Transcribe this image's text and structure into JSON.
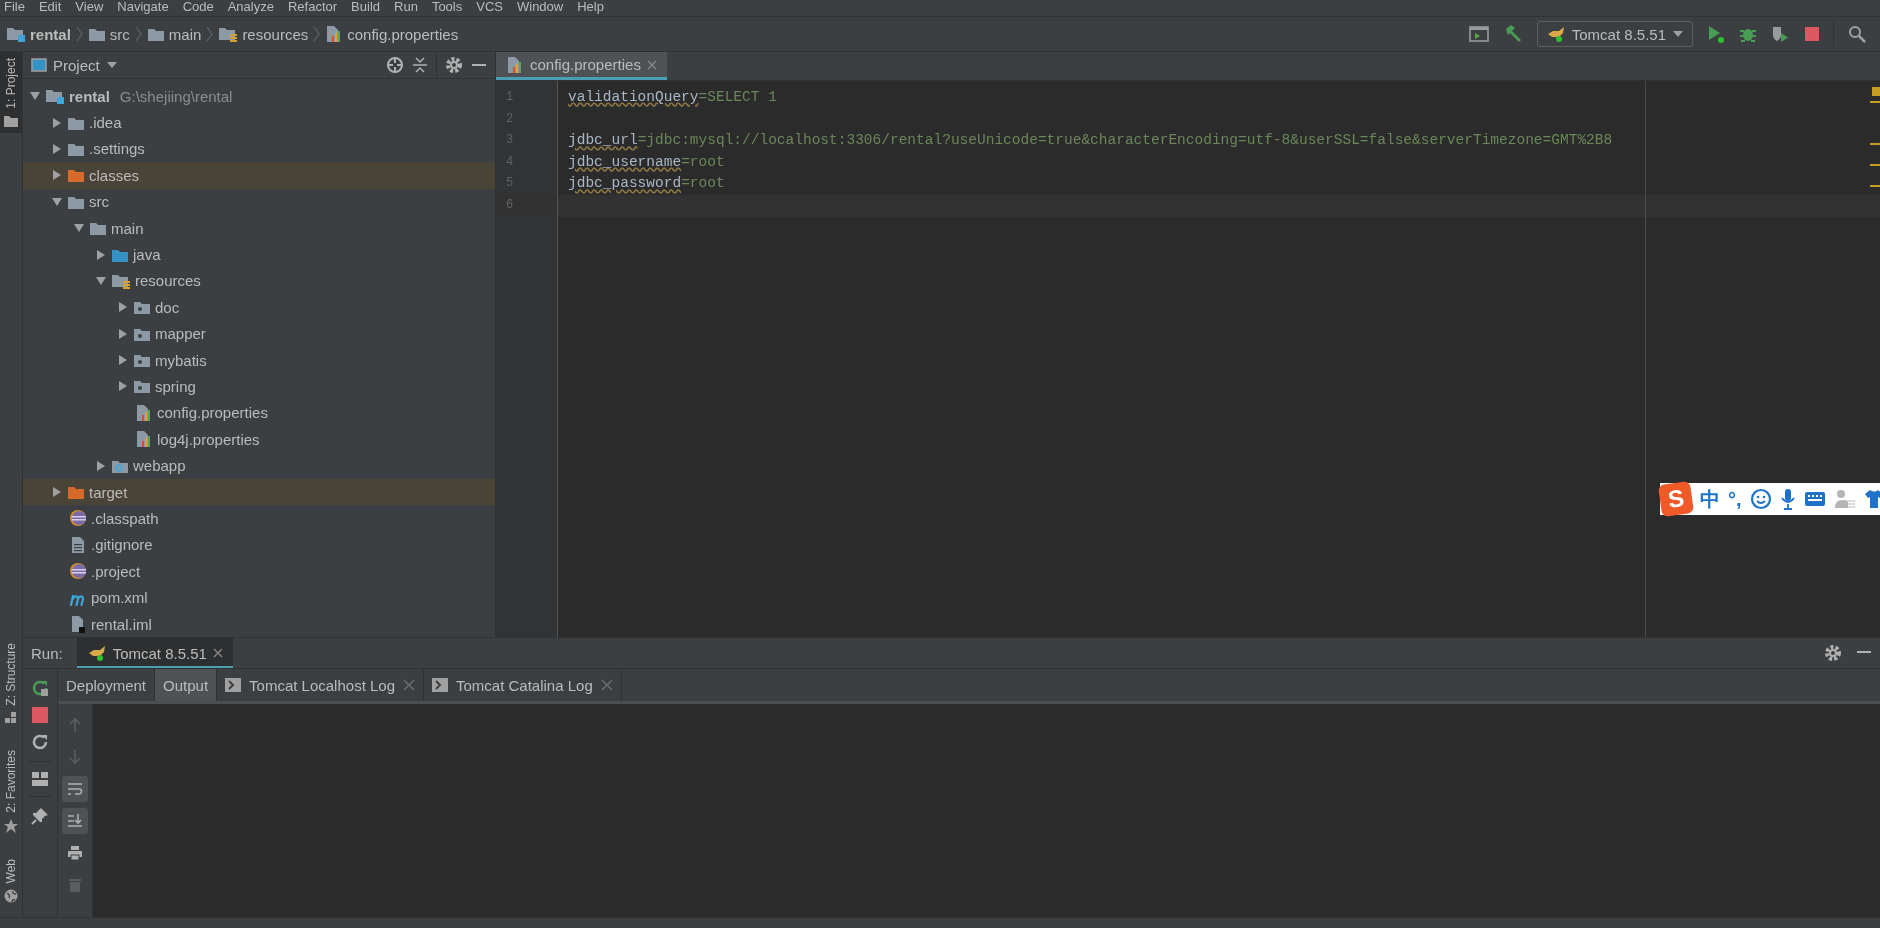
{
  "menu_bar": [
    "File",
    "Edit",
    "View",
    "Navigate",
    "Code",
    "Analyze",
    "Refactor",
    "Build",
    "Run",
    "Tools",
    "VCS",
    "Window",
    "Help"
  ],
  "breadcrumbs": [
    {
      "label": "rental",
      "kind": "module"
    },
    {
      "label": "src",
      "kind": "folder"
    },
    {
      "label": "main",
      "kind": "folder"
    },
    {
      "label": "resources",
      "kind": "resources"
    },
    {
      "label": "config.properties",
      "kind": "properties"
    }
  ],
  "toolbar": {
    "run_config": "Tomcat 8.5.51"
  },
  "left_stripe": {
    "top": [
      {
        "label": "1: Project",
        "selected": true
      }
    ],
    "bottom": [
      {
        "label": "Z: Structure",
        "kind": "structure",
        "selected": false
      },
      {
        "label": "2: Favorites",
        "kind": "favorites",
        "selected": false
      },
      {
        "label": "Web",
        "kind": "web",
        "selected": false
      }
    ]
  },
  "project_panel": {
    "title": "Project",
    "tree": [
      {
        "label": "rental",
        "path": "G:\\shejiing\\rental",
        "kind": "module",
        "expanded": true,
        "children": [
          {
            "label": ".idea",
            "kind": "folder",
            "expanded": false
          },
          {
            "label": ".settings",
            "kind": "folder",
            "expanded": false
          },
          {
            "label": "classes",
            "kind": "excluded",
            "expanded": false
          },
          {
            "label": "src",
            "kind": "folder",
            "expanded": true,
            "children": [
              {
                "label": "main",
                "kind": "folder",
                "expanded": true,
                "children": [
                  {
                    "label": "java",
                    "kind": "source",
                    "expanded": false
                  },
                  {
                    "label": "resources",
                    "kind": "resources",
                    "expanded": true,
                    "children": [
                      {
                        "label": "doc",
                        "kind": "package",
                        "expanded": false
                      },
                      {
                        "label": "mapper",
                        "kind": "package",
                        "expanded": false
                      },
                      {
                        "label": "mybatis",
                        "kind": "package",
                        "expanded": false
                      },
                      {
                        "label": "spring",
                        "kind": "package",
                        "expanded": false
                      },
                      {
                        "label": "config.properties",
                        "kind": "properties"
                      },
                      {
                        "label": "log4j.properties",
                        "kind": "properties"
                      }
                    ]
                  },
                  {
                    "label": "webapp",
                    "kind": "web",
                    "expanded": false
                  }
                ]
              }
            ]
          },
          {
            "label": "target",
            "kind": "excluded",
            "expanded": false
          },
          {
            "label": ".classpath",
            "kind": "eclipse"
          },
          {
            "label": ".gitignore",
            "kind": "text"
          },
          {
            "label": ".project",
            "kind": "eclipse"
          },
          {
            "label": "pom.xml",
            "kind": "maven"
          },
          {
            "label": "rental.iml",
            "kind": "iml"
          }
        ]
      }
    ]
  },
  "editor": {
    "tabs": [
      {
        "label": "config.properties",
        "selected": true
      }
    ],
    "lines": [
      {
        "number": "1",
        "key": "validationQuery",
        "separator": "=",
        "value": "SELECT 1",
        "warning": true
      },
      {
        "number": "2"
      },
      {
        "number": "3",
        "key": "jdbc_url",
        "separator": "=",
        "value": "jdbc:mysql://localhost:3306/rental?useUnicode=true&characterEncoding=utf-8&userSSL=false&serverTimezone=GMT%2B8",
        "warning": true
      },
      {
        "number": "4",
        "key": "jdbc_username",
        "separator": "=",
        "value": "root",
        "warning": true
      },
      {
        "number": "5",
        "key": "jdbc_password",
        "separator": "=",
        "value": "root",
        "warning": true
      },
      {
        "number": "6",
        "current": true
      }
    ]
  },
  "run_panel": {
    "label": "Run:",
    "tabs": [
      {
        "label": "Tomcat 8.5.51",
        "selected": true
      }
    ],
    "subtabs": [
      {
        "label": "Deployment",
        "selected": false,
        "closable": false,
        "kind": "plain"
      },
      {
        "label": "Output",
        "selected": true,
        "closable": false,
        "kind": "plain"
      },
      {
        "label": "Tomcat Localhost Log",
        "selected": false,
        "closable": true,
        "kind": "log"
      },
      {
        "label": "Tomcat Catalina Log",
        "selected": false,
        "closable": true,
        "kind": "log"
      }
    ],
    "output_tools": [
      {
        "kind": "up",
        "disabled": true,
        "on": false
      },
      {
        "kind": "down",
        "disabled": true,
        "on": false
      },
      {
        "kind": "wrap",
        "disabled": false,
        "on": true
      },
      {
        "kind": "scroll",
        "disabled": false,
        "on": true
      },
      {
        "kind": "print",
        "disabled": false,
        "on": false
      },
      {
        "kind": "trash",
        "disabled": true,
        "on": false
      }
    ]
  },
  "ime_bar": {
    "logo": "S",
    "mode": "中",
    "punctuation": "°,"
  }
}
